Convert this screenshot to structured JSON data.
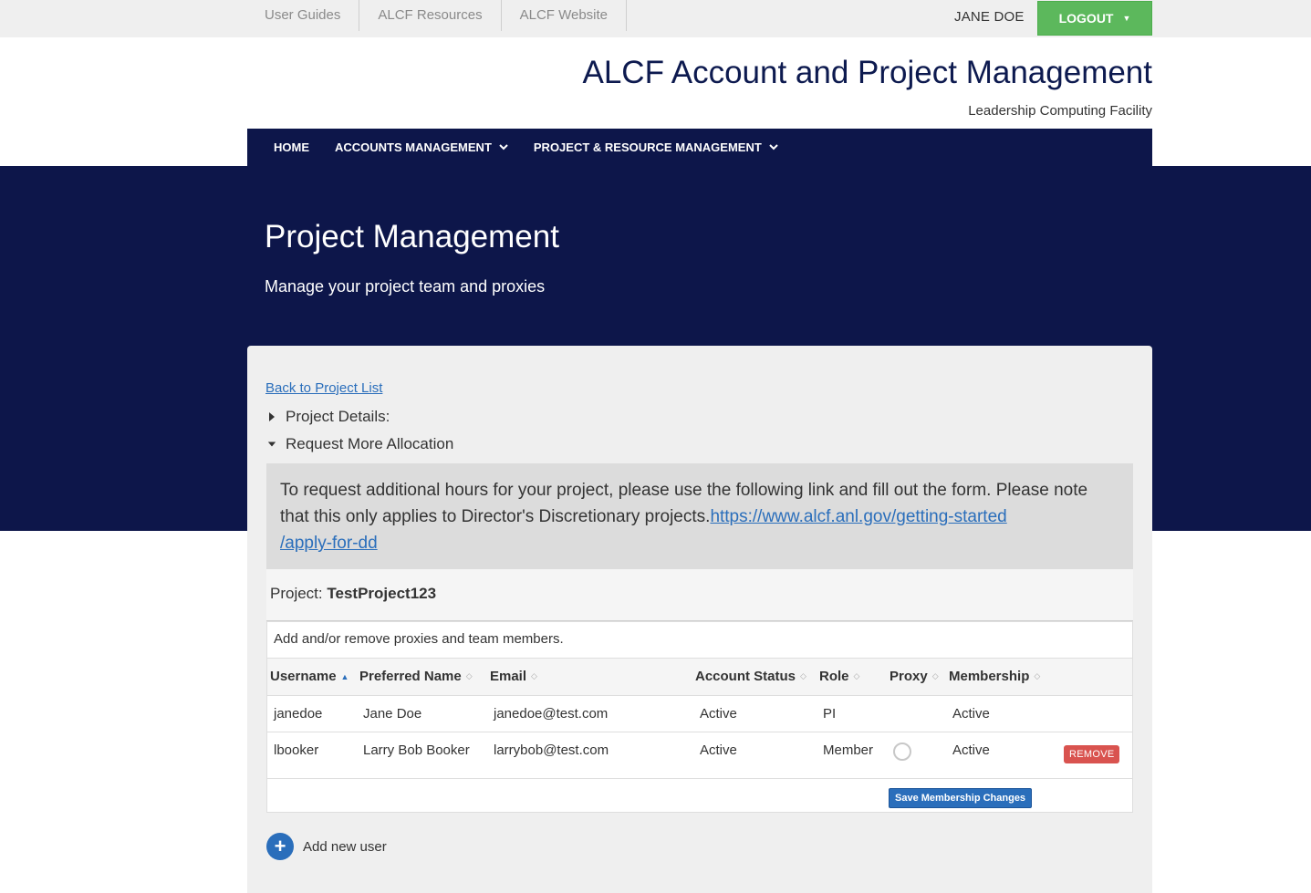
{
  "topbar": {
    "links": [
      "User Guides",
      "ALCF Resources",
      "ALCF Website"
    ],
    "username": "JANE DOE",
    "logout_label": "LOGOUT",
    "logout_caret": "▼"
  },
  "header": {
    "title": "ALCF Account and Project Management",
    "subtitle": "Leadership Computing Facility"
  },
  "nav": {
    "home": "HOME",
    "accounts": "ACCOUNTS MANAGEMENT",
    "projects": "PROJECT & RESOURCE MANAGEMENT"
  },
  "hero": {
    "title": "Project Management",
    "subtitle": "Manage your project team and proxies"
  },
  "panel": {
    "back_link": "Back to Project List",
    "details_label": "Project Details:",
    "alloc_label": "Request More Allocation",
    "alloc_text": "To request additional hours for your project, please use the following link and fill out the form. Please note that this only applies to Director's Discretionary projects.",
    "alloc_link_line1": "https://www.alcf.anl.gov/getting-started",
    "alloc_link_line2": "/apply-for-dd",
    "project_label": "Project:",
    "project_name": "TestProject123",
    "team_intro": "Add and/or remove proxies and team members.",
    "save_label": "Save Membership Changes",
    "add_user_label": "Add new user"
  },
  "table": {
    "headers": {
      "username": "Username",
      "preferred": "Preferred Name",
      "email": "Email",
      "status": "Account Status",
      "role": "Role",
      "proxy": "Proxy",
      "membership": "Membership"
    },
    "rows": [
      {
        "username": "janedoe",
        "preferred": "Jane Doe",
        "email": "janedoe@test.com",
        "status": "Active",
        "role": "PI",
        "membership": "Active"
      },
      {
        "username": "lbooker",
        "preferred": "Larry Bob Booker",
        "email": "larrybob@test.com",
        "status": "Active",
        "role": "Member",
        "membership": "Active",
        "remove_label": "REMOVE"
      }
    ]
  },
  "colors": {
    "navy": "#0d164a",
    "logout_green": "#5cb85c",
    "link_blue": "#2a6ebb",
    "remove_red": "#d9534f"
  },
  "icons": {
    "sort_active": "▲",
    "sort_inactive": "◇",
    "nav_chevron": "chevron-down-icon",
    "add": "plus-circle-icon"
  }
}
